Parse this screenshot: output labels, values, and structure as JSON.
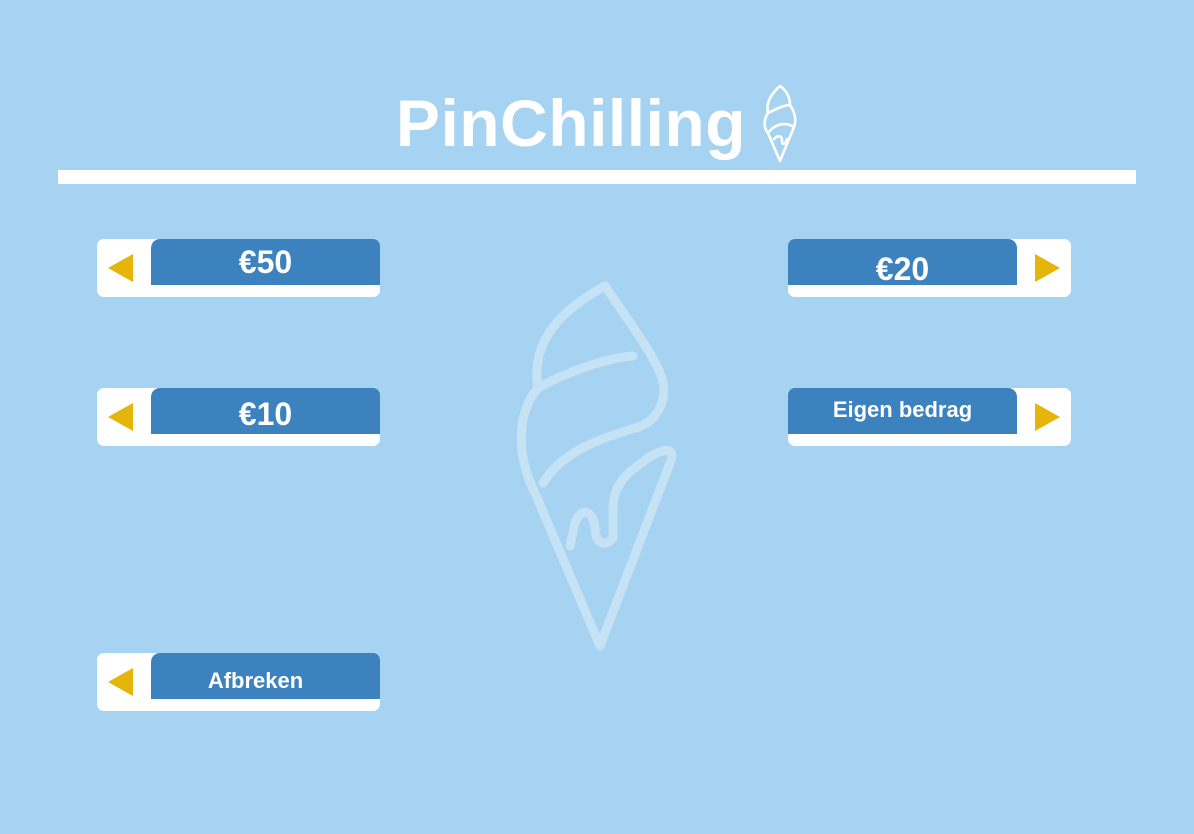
{
  "header": {
    "title": "PinChilling",
    "logo_icon": "ice-cream-cone-icon"
  },
  "background": {
    "color": "#a7d3f2",
    "watermark_icon": "ice-cream-cone-icon"
  },
  "colors": {
    "button_bar": "#3c82bf",
    "button_base": "#ffffff",
    "arrow": "#e5b50a",
    "text": "#ffffff"
  },
  "buttons": {
    "amount_50": {
      "label": "€50",
      "arrow_icon": "arrow-left-icon"
    },
    "amount_10": {
      "label": "€10",
      "arrow_icon": "arrow-left-icon"
    },
    "cancel": {
      "label": "Afbreken",
      "arrow_icon": "arrow-left-icon"
    },
    "amount_20": {
      "label": "€20",
      "arrow_icon": "arrow-right-icon"
    },
    "custom_amount": {
      "label": "Eigen bedrag",
      "arrow_icon": "arrow-right-icon"
    }
  }
}
